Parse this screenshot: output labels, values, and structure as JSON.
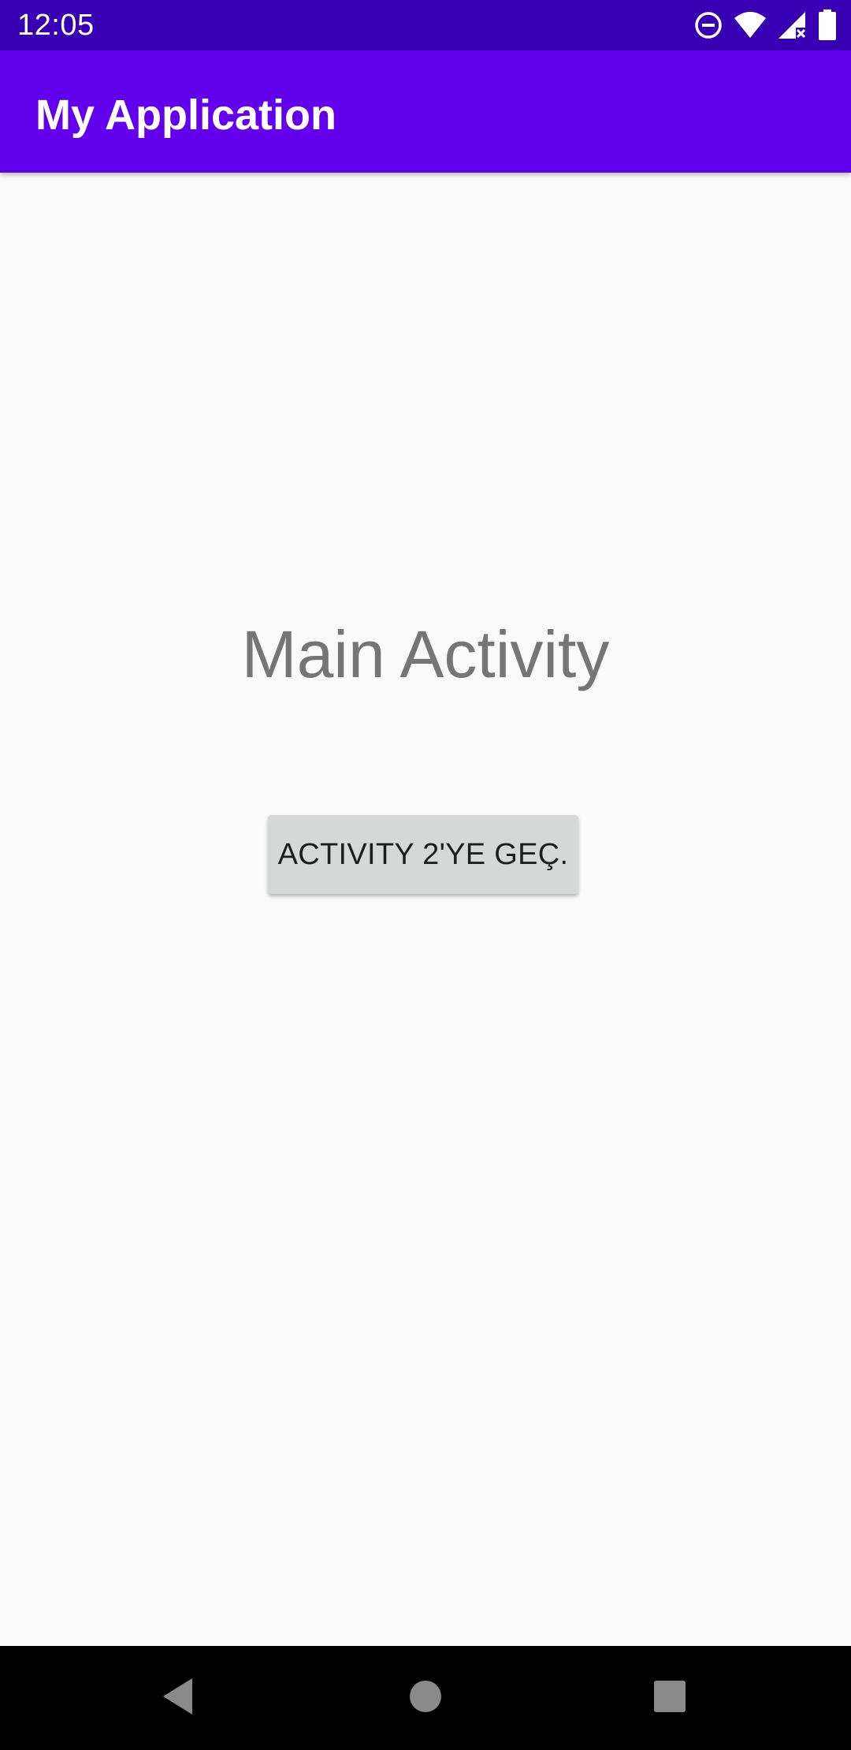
{
  "status_bar": {
    "time": "12:05",
    "icons": [
      "do-not-disturb-icon",
      "wifi-icon",
      "signal-icon",
      "battery-icon"
    ],
    "background": "#3700b3"
  },
  "app_bar": {
    "title": "My Application",
    "background": "#6200ee"
  },
  "main": {
    "heading": "Main Activity",
    "button_label": "ACTIVITY 2'YE GEÇ."
  },
  "nav_bar": {
    "buttons": [
      "back-icon",
      "home-icon",
      "recents-icon"
    ]
  }
}
